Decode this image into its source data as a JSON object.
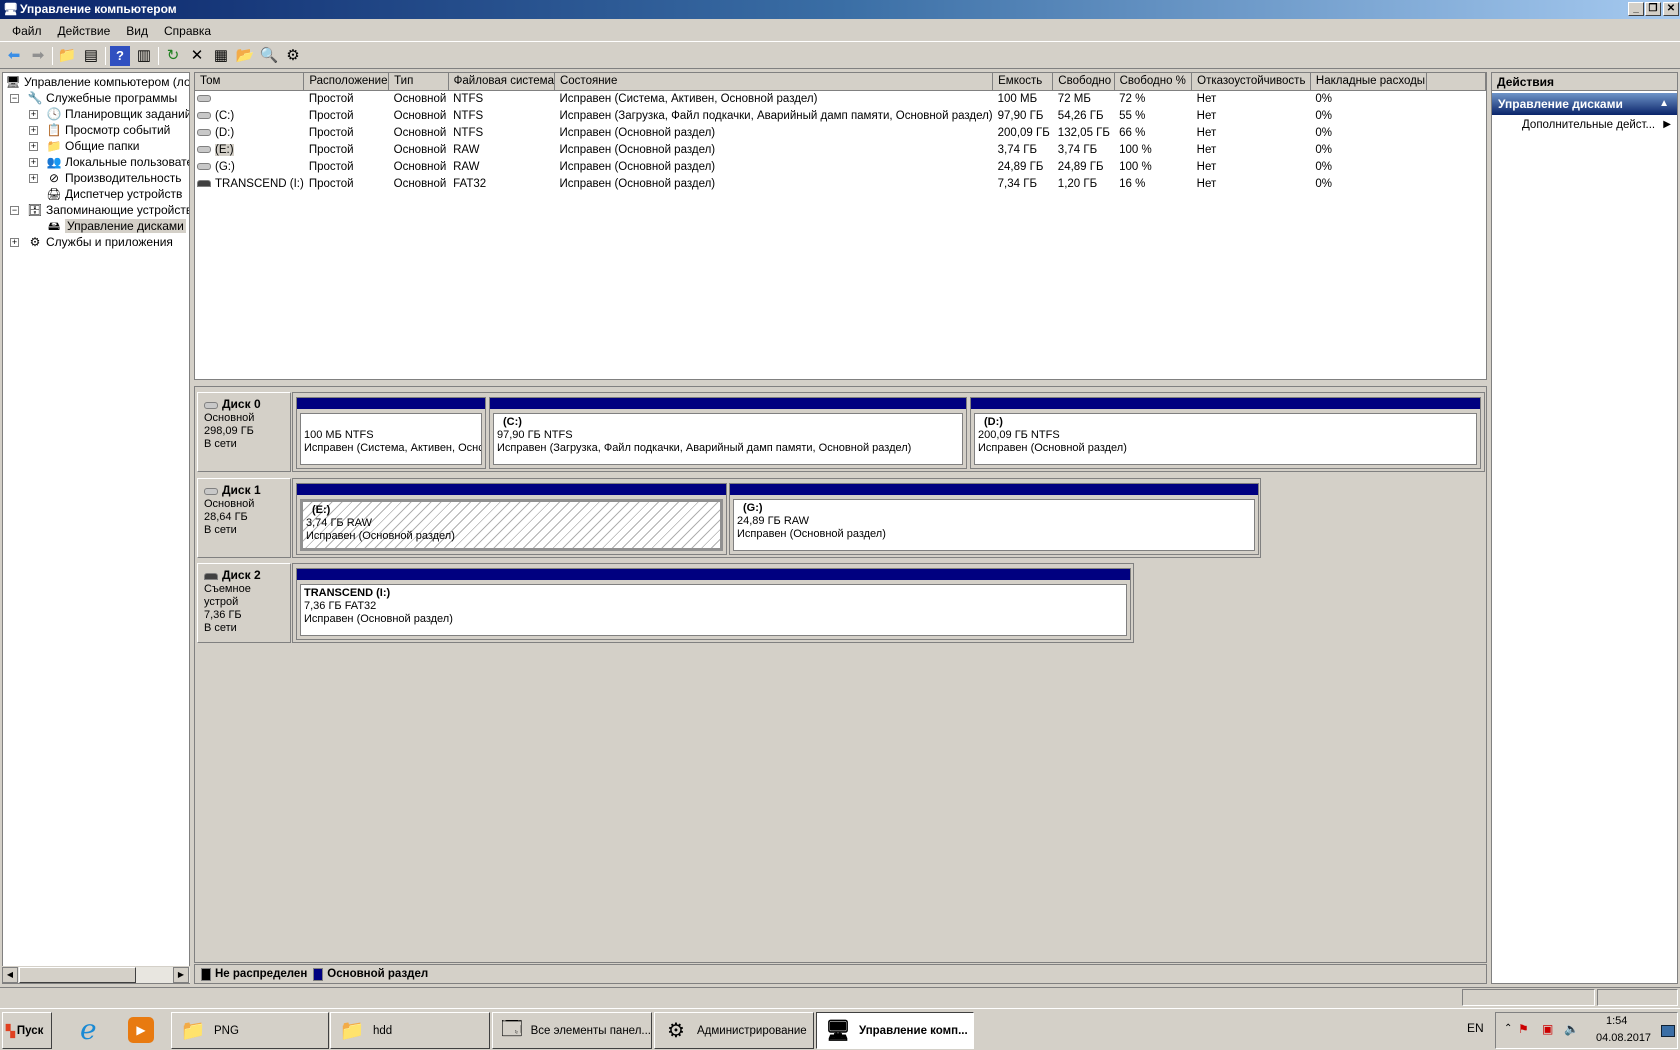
{
  "window": {
    "title": "Управление компьютером",
    "min": "_",
    "max": "❐",
    "close": "✕"
  },
  "menu": [
    "Файл",
    "Действие",
    "Вид",
    "Справка"
  ],
  "toolbar": {
    "icons": [
      "back-icon",
      "forward-icon",
      "up-folder-icon",
      "show-hide-tree-icon",
      "help-icon",
      "show-hide-action-icon",
      "refresh-icon",
      "delete-icon",
      "properties-icon",
      "open-icon",
      "search-icon",
      "settings-icon"
    ]
  },
  "tree": {
    "root": "Управление компьютером (лока",
    "items": [
      {
        "label": "Служебные программы",
        "expander": "−"
      },
      {
        "label": "Планировщик заданий",
        "expander": "+"
      },
      {
        "label": "Просмотр событий",
        "expander": "+"
      },
      {
        "label": "Общие папки",
        "expander": "+"
      },
      {
        "label": "Локальные пользовател",
        "expander": "+"
      },
      {
        "label": "Производительность",
        "expander": "+"
      },
      {
        "label": "Диспетчер устройств",
        "expander": ""
      },
      {
        "label": "Запоминающие устройства",
        "expander": "−"
      },
      {
        "label": "Управление дисками",
        "expander": ""
      },
      {
        "label": "Службы и приложения",
        "expander": "+"
      }
    ]
  },
  "table": {
    "columns": [
      "Том",
      "Расположение",
      "Тип",
      "Файловая система",
      "Состояние",
      "Емкость",
      "Свободно",
      "Свободно %",
      "Отказоустойчивость",
      "Накладные расходы"
    ],
    "rows": [
      [
        "",
        "Простой",
        "Основной",
        "NTFS",
        "Исправен (Система, Активен, Основной раздел)",
        "100 МБ",
        "72 МБ",
        "72 %",
        "Нет",
        "0%"
      ],
      [
        "(C:)",
        "Простой",
        "Основной",
        "NTFS",
        "Исправен (Загрузка, Файл подкачки, Аварийный дамп памяти, Основной раздел)",
        "97,90 ГБ",
        "54,26 ГБ",
        "55 %",
        "Нет",
        "0%"
      ],
      [
        "(D:)",
        "Простой",
        "Основной",
        "NTFS",
        "Исправен (Основной раздел)",
        "200,09 ГБ",
        "132,05 ГБ",
        "66 %",
        "Нет",
        "0%"
      ],
      [
        "(E:)",
        "Простой",
        "Основной",
        "RAW",
        "Исправен (Основной раздел)",
        "3,74 ГБ",
        "3,74 ГБ",
        "100 %",
        "Нет",
        "0%"
      ],
      [
        "(G:)",
        "Простой",
        "Основной",
        "RAW",
        "Исправен (Основной раздел)",
        "24,89 ГБ",
        "24,89 ГБ",
        "100 %",
        "Нет",
        "0%"
      ],
      [
        "TRANSCEND (I:)",
        "Простой",
        "Основной",
        "FAT32",
        "Исправен (Основной раздел)",
        "7,34 ГБ",
        "1,20 ГБ",
        "16 %",
        "Нет",
        "0%"
      ]
    ]
  },
  "disks": [
    {
      "name": "Диск 0",
      "type": "Основной",
      "size": "298,09 ГБ",
      "status": "В сети",
      "parts": [
        {
          "title": "",
          "size": "100 МБ NTFS",
          "state": "Исправен (Система, Активен, Оснс"
        },
        {
          "title": "(C:)",
          "size": "97,90 ГБ NTFS",
          "state": "Исправен (Загрузка, Файл подкачки, Аварийный дамп памяти, Основной раздел)"
        },
        {
          "title": "(D:)",
          "size": "200,09 ГБ NTFS",
          "state": "Исправен (Основной раздел)"
        }
      ]
    },
    {
      "name": "Диск 1",
      "type": "Основной",
      "size": "28,64 ГБ",
      "status": "В сети",
      "parts": [
        {
          "title": "(E:)",
          "size": "3,74 ГБ RAW",
          "state": "Исправен (Основной раздел)"
        },
        {
          "title": "(G:)",
          "size": "24,89 ГБ RAW",
          "state": "Исправен (Основной раздел)"
        }
      ]
    },
    {
      "name": "Диск 2",
      "type": "Съемное устрой",
      "size": "7,36 ГБ",
      "status": "В сети",
      "parts": [
        {
          "title": "TRANSCEND  (I:)",
          "size": "7,36 ГБ FAT32",
          "state": "Исправен (Основной раздел)"
        }
      ]
    }
  ],
  "legend": [
    {
      "label": "Не распределен",
      "color": "#000000"
    },
    {
      "label": "Основной раздел",
      "color": "#000080"
    }
  ],
  "actions": {
    "header": "Действия",
    "section": "Управление дисками",
    "more": "Дополнительные дейст..."
  },
  "taskbar": {
    "start": "Пуск",
    "tasks": [
      "PNG",
      "hdd",
      "Все элементы панел...",
      "Администрирование",
      "Управление комп..."
    ],
    "lang": "EN",
    "time": "1:54",
    "date": "04.08.2017"
  }
}
